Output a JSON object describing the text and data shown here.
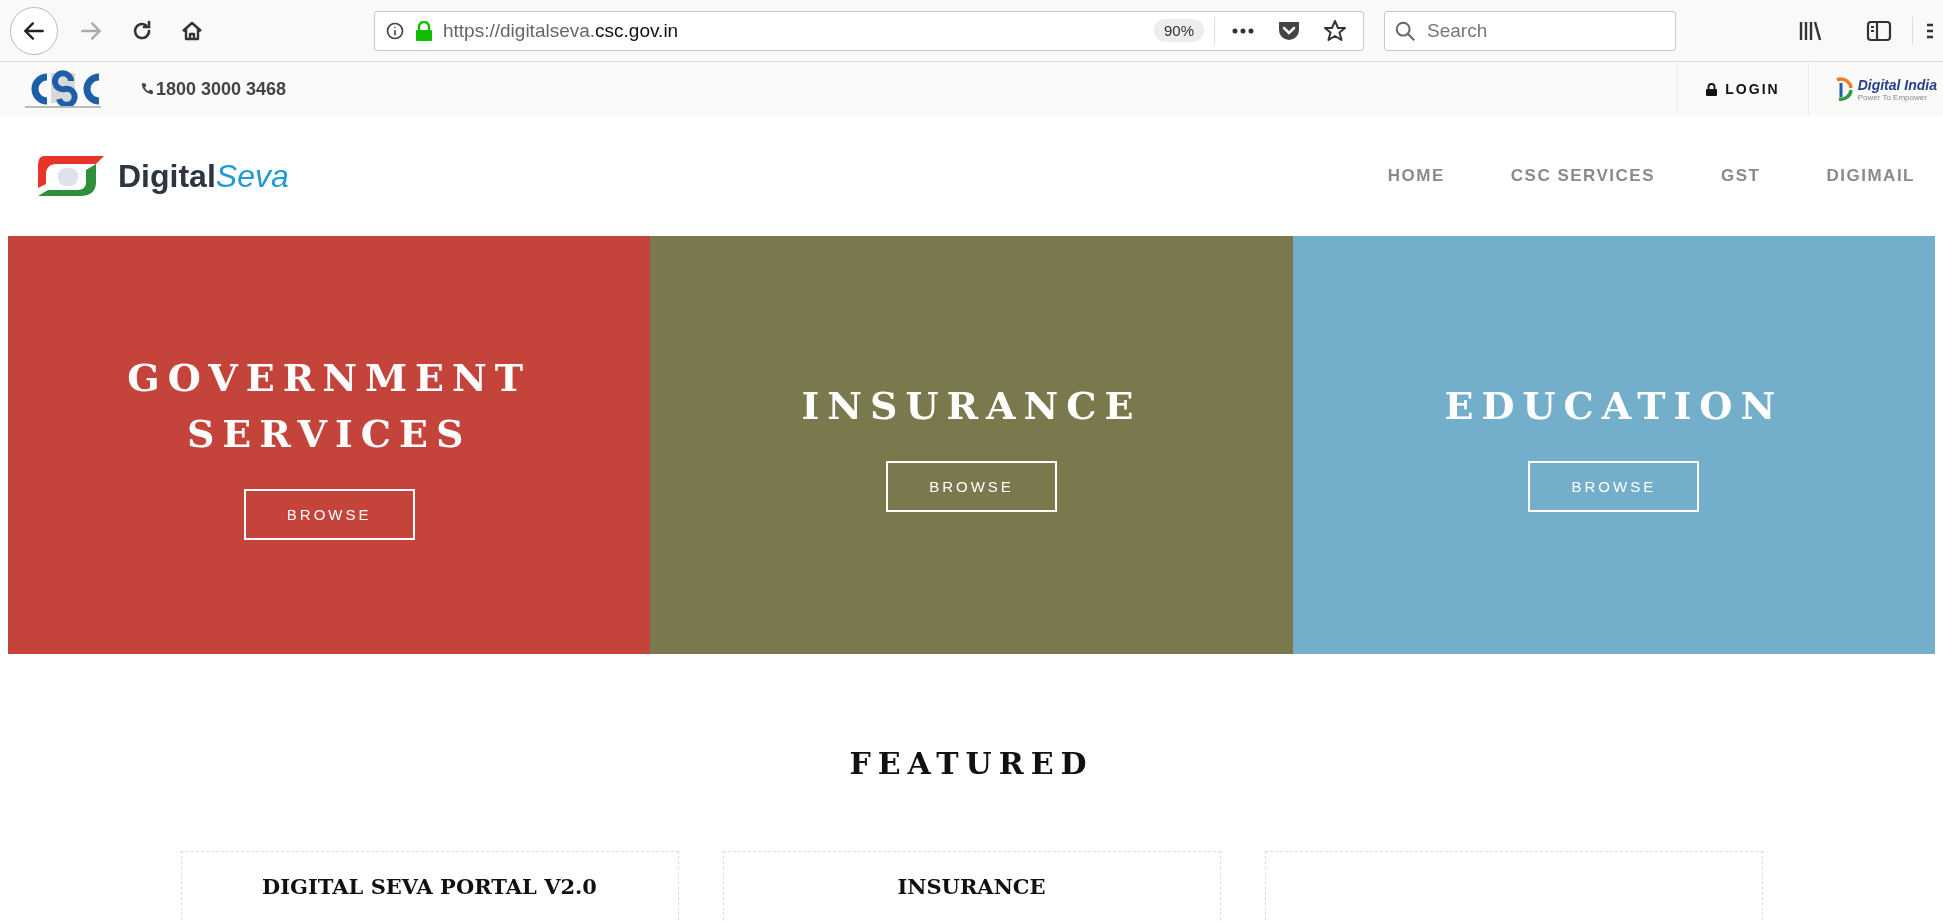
{
  "browser": {
    "url_prefix": "https://digitalseva.",
    "url_domain": "csc.gov.in",
    "zoom": "90%",
    "search": {
      "placeholder": "Search"
    }
  },
  "topbar": {
    "phone": "1800 3000 3468",
    "login": "LOGIN",
    "partner": {
      "title": "Digital India",
      "tagline": "Power To Empower"
    }
  },
  "header": {
    "logo": {
      "first": "Digital",
      "second": "Seva"
    },
    "nav": [
      {
        "label": "HOME"
      },
      {
        "label": "CSC SERVICES"
      },
      {
        "label": "GST"
      },
      {
        "label": "DIGIMAIL"
      }
    ]
  },
  "hero": [
    {
      "title_lines": [
        "GOVERNMENT",
        "SERVICES"
      ],
      "button": "BROWSE",
      "color": "#c4443b"
    },
    {
      "title_lines": [
        "INSURANCE"
      ],
      "button": "BROWSE",
      "color": "#79794d"
    },
    {
      "title_lines": [
        "EDUCATION"
      ],
      "button": "BROWSE",
      "color": "#73afcb"
    }
  ],
  "featured": {
    "heading": "FEATURED",
    "cards": [
      {
        "kind": "titled",
        "title": "DIGITAL SEVA PORTAL V2.0"
      },
      {
        "kind": "titled",
        "title": "INSURANCE"
      },
      {
        "kind": "blank"
      }
    ]
  }
}
